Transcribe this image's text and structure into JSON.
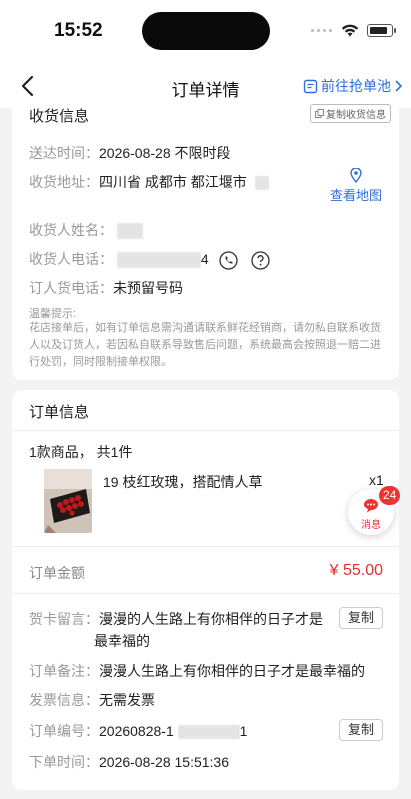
{
  "status": {
    "time": "15:52"
  },
  "nav": {
    "title": "订单详情",
    "right_link": "前往抢单池"
  },
  "delivery": {
    "section_title": "收货信息",
    "copy_label": "复制收货信息",
    "delivery_time_label": "送达时间：",
    "delivery_time_value": "2026-08-28 不限时段",
    "address_label": "收货地址：",
    "address_value": "四川省 成都市 都江堰市",
    "map_link": "查看地图",
    "recipient_name_label": "收货人姓名：",
    "recipient_phone_label": "收货人电话：",
    "phone_suffix": "4",
    "orderer_phone_label": "订人货电话：",
    "orderer_phone_value": "未预留号码",
    "tip_title": "温馨提示:",
    "tip_body": "花店接单后，如有订单信息需沟通请联系鲜花经销商，请勿私自联系收货人以及订货人，若因私自联系导致售后问题，系统最高会按照退一赔二进行处罚，同时限制接单权限。"
  },
  "order": {
    "section_title": "订单信息",
    "items_summary": "1款商品，  共1件",
    "product_name": "19 枝红玫瑰，搭配情人草",
    "quantity": "x1",
    "message_badge_count": "24",
    "message_label": "消息",
    "amount_label": "订单金额",
    "amount_value": "¥ 55.00",
    "card_message_label": "贺卡留言：",
    "card_message_value_line1": "漫漫的人生路上有你相伴的日子才是",
    "card_message_value_line2": "最幸福的",
    "copy_label": "复制",
    "remark_label": "订单备注：",
    "remark_value": "漫漫人生路上有你相伴的日子才是最幸福的",
    "invoice_label": "发票信息：",
    "invoice_value": "无需发票",
    "order_no_label": "订单编号：",
    "order_no_prefix": "20260828-1",
    "order_no_suffix": "1",
    "order_time_label": "下单时间：",
    "order_time_value": "2026-08-28 15:51:36"
  },
  "colors": {
    "accent": "#2f6fd8",
    "price": "#e52e2e",
    "badge": "#e33333"
  }
}
